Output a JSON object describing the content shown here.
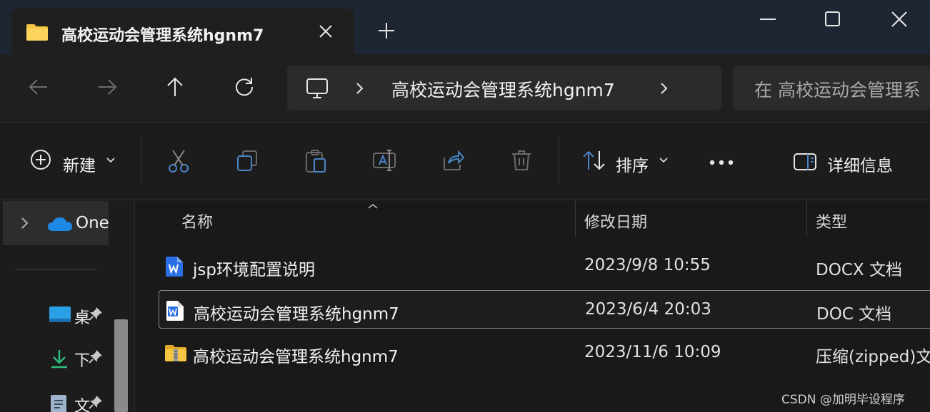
{
  "tab": {
    "title": "高校运动会管理系统hgnm7"
  },
  "address": {
    "path": "高校运动会管理系统hgnm7",
    "search_placeholder": "在 高校运动会管理系"
  },
  "commands": {
    "new_label": "新建",
    "sort_label": "排序",
    "details_label": "详细信息"
  },
  "nav": {
    "onedrive_label": "One",
    "quick_access": [
      {
        "label": "桌",
        "icon": "desktop-icon"
      },
      {
        "label": "下",
        "icon": "download-icon"
      },
      {
        "label": "文",
        "icon": "document-icon"
      }
    ]
  },
  "columns": {
    "name": "名称",
    "modified": "修改日期",
    "type": "类型"
  },
  "files": [
    {
      "name": "jsp环境配置说明",
      "modified": "2023/9/8 10:55",
      "type": "DOCX 文档",
      "icon": "word-doc-icon"
    },
    {
      "name": "高校运动会管理系统hgnm7",
      "modified": "2023/6/4 20:03",
      "type": "DOC 文档",
      "icon": "word-doc-icon",
      "selected": true
    },
    {
      "name": "高校运动会管理系统hgnm7",
      "modified": "2023/11/6 10:09",
      "type": "压缩(zipped)文",
      "icon": "zip-folder-icon"
    }
  ],
  "watermark": "CSDN @加明毕设程序",
  "colors": {
    "accent": "#4cc2ff",
    "word_blue": "#2b6fe6",
    "folder_yellow": "#f5c542"
  }
}
